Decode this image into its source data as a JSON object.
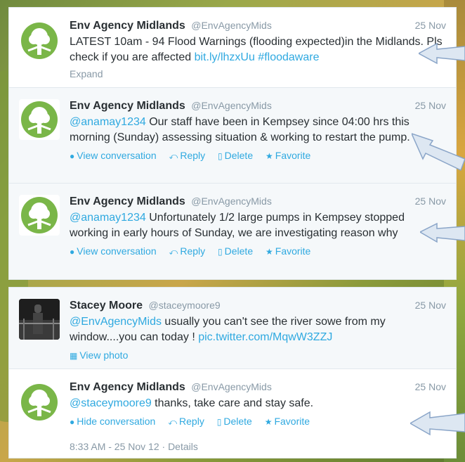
{
  "tweets": [
    {
      "name": "Env Agency Midlands",
      "handle": "@EnvAgencyMids",
      "date": "25 Nov",
      "text_pre": "LATEST 10am - 94 Flood Warnings (flooding expected)in the Midlands. Pls check if you are affected ",
      "link1": "bit.ly/lhzxUu",
      "link2": "#floodaware",
      "expand": "Expand"
    },
    {
      "name": "Env Agency Midlands",
      "handle": "@EnvAgencyMids",
      "date": "25 Nov",
      "mention": "@anamay1234",
      "text": " Our staff have been in Kempsey since 04:00 hrs this morning (Sunday) assessing situation & working to restart the pump.",
      "actions": [
        "View conversation",
        "Reply",
        "Delete",
        "Favorite"
      ]
    },
    {
      "name": "Env Agency Midlands",
      "handle": "@EnvAgencyMids",
      "date": "25 Nov",
      "mention": "@anamay1234",
      "text": " Unfortunately 1/2 large pumps in Kempsey stopped working in early hours of Sunday, we are investigating reason why",
      "actions": [
        "View conversation",
        "Reply",
        "Delete",
        "Favorite"
      ]
    },
    {
      "name": "Stacey Moore",
      "handle": "@staceymoore9",
      "date": "25 Nov",
      "mention": "@EnvAgencyMids",
      "text": " usually you can't see the river sowe from my window....you can today ! ",
      "link": "pic.twitter.com/MqwW3ZZJ",
      "action": "View photo"
    },
    {
      "name": "Env Agency Midlands",
      "handle": "@EnvAgencyMids",
      "date": "25 Nov",
      "mention": "@staceymoore9",
      "text": " thanks, take care and stay safe.",
      "actions": [
        "Hide conversation",
        "Reply",
        "Delete",
        "Favorite"
      ],
      "footer": "8:33 AM - 25 Nov 12 · Details"
    }
  ],
  "colors": {
    "link": "#2fa9e0",
    "name": "#292f33",
    "muted": "#8899a6",
    "logo": "#7ab648"
  },
  "icons": {
    "conversation": "speech-bubble-icon",
    "reply": "reply-arrow-icon",
    "delete": "trash-icon",
    "favorite": "star-icon",
    "photo": "photo-icon",
    "pointer": "callout-arrow-icon"
  }
}
